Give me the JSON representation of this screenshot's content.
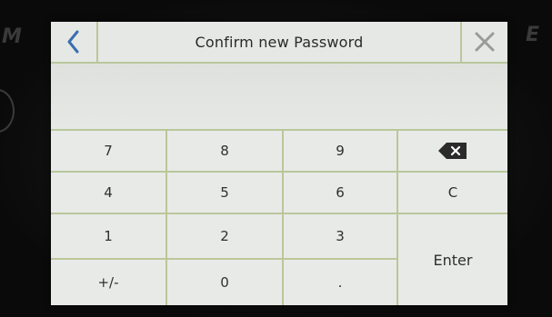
{
  "dialog": {
    "title": "Confirm new Password",
    "entered_value": ""
  },
  "icons": {
    "back": "chevron-left-icon",
    "close": "close-x-icon",
    "backspace": "backspace-icon"
  },
  "colors": {
    "accent_blue": "#3a6fb0",
    "close_grey": "#9a9a9a",
    "grid_lines": "#b9c79a",
    "key_background": "#e8eae7"
  },
  "keypad": {
    "k7": "7",
    "k8": "8",
    "k9": "9",
    "k4": "4",
    "k5": "5",
    "k6": "6",
    "k1": "1",
    "k2": "2",
    "k3": "3",
    "sign": "+/-",
    "k0": "0",
    "dot": ".",
    "clear": "C",
    "enter": "Enter"
  }
}
